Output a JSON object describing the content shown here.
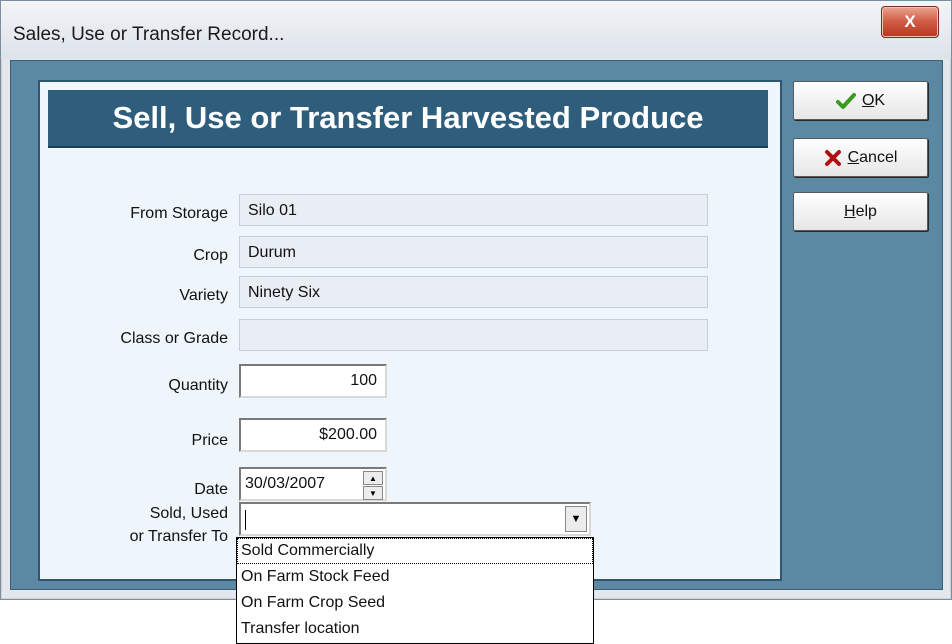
{
  "window": {
    "title": "Sales, Use or Transfer Record...",
    "close_label": "X"
  },
  "form": {
    "heading": "Sell, Use or Transfer Harvested Produce",
    "fields": {
      "from_storage": {
        "label": "From Storage",
        "value": "Silo 01"
      },
      "crop": {
        "label": "Crop",
        "value": "Durum"
      },
      "variety": {
        "label": "Variety",
        "value": "Ninety Six"
      },
      "class_grade": {
        "label": "Class or Grade",
        "value": ""
      },
      "quantity": {
        "label": "Quantity",
        "value": "100"
      },
      "price": {
        "label": "Price",
        "value": "$200.00"
      },
      "date": {
        "label": "Date",
        "value": "30/03/2007"
      },
      "sold_to": {
        "label_line1": "Sold,  Used",
        "label_line2": "or Transfer To",
        "value": ""
      }
    }
  },
  "buttons": {
    "ok": {
      "label": "OK",
      "mnemonic": "O",
      "rest": "K"
    },
    "cancel": {
      "label": "Cancel",
      "mnemonic": "C",
      "rest": "ancel"
    },
    "help": {
      "label": "Help",
      "mnemonic": "H",
      "rest": "elp"
    }
  },
  "dropdown": {
    "options": [
      "Sold Commercially",
      "On Farm Stock Feed",
      "On Farm Crop Seed",
      "Transfer location"
    ],
    "focused_index": 0
  },
  "colors": {
    "banner": "#2e5e7c",
    "frame": "#5b89a4",
    "panel": "#eef5fb",
    "ok_check": "#3a9a1e",
    "cancel_x": "#b01010"
  }
}
